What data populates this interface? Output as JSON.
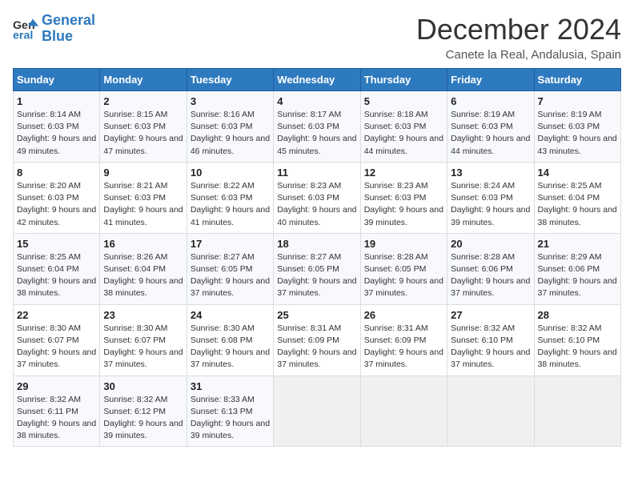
{
  "header": {
    "logo_line1": "General",
    "logo_line2": "Blue",
    "month_title": "December 2024",
    "location": "Canete la Real, Andalusia, Spain"
  },
  "weekdays": [
    "Sunday",
    "Monday",
    "Tuesday",
    "Wednesday",
    "Thursday",
    "Friday",
    "Saturday"
  ],
  "weeks": [
    [
      {
        "day": "1",
        "sunrise": "Sunrise: 8:14 AM",
        "sunset": "Sunset: 6:03 PM",
        "daylight": "Daylight: 9 hours and 49 minutes."
      },
      {
        "day": "2",
        "sunrise": "Sunrise: 8:15 AM",
        "sunset": "Sunset: 6:03 PM",
        "daylight": "Daylight: 9 hours and 47 minutes."
      },
      {
        "day": "3",
        "sunrise": "Sunrise: 8:16 AM",
        "sunset": "Sunset: 6:03 PM",
        "daylight": "Daylight: 9 hours and 46 minutes."
      },
      {
        "day": "4",
        "sunrise": "Sunrise: 8:17 AM",
        "sunset": "Sunset: 6:03 PM",
        "daylight": "Daylight: 9 hours and 45 minutes."
      },
      {
        "day": "5",
        "sunrise": "Sunrise: 8:18 AM",
        "sunset": "Sunset: 6:03 PM",
        "daylight": "Daylight: 9 hours and 44 minutes."
      },
      {
        "day": "6",
        "sunrise": "Sunrise: 8:19 AM",
        "sunset": "Sunset: 6:03 PM",
        "daylight": "Daylight: 9 hours and 44 minutes."
      },
      {
        "day": "7",
        "sunrise": "Sunrise: 8:19 AM",
        "sunset": "Sunset: 6:03 PM",
        "daylight": "Daylight: 9 hours and 43 minutes."
      }
    ],
    [
      {
        "day": "8",
        "sunrise": "Sunrise: 8:20 AM",
        "sunset": "Sunset: 6:03 PM",
        "daylight": "Daylight: 9 hours and 42 minutes."
      },
      {
        "day": "9",
        "sunrise": "Sunrise: 8:21 AM",
        "sunset": "Sunset: 6:03 PM",
        "daylight": "Daylight: 9 hours and 41 minutes."
      },
      {
        "day": "10",
        "sunrise": "Sunrise: 8:22 AM",
        "sunset": "Sunset: 6:03 PM",
        "daylight": "Daylight: 9 hours and 41 minutes."
      },
      {
        "day": "11",
        "sunrise": "Sunrise: 8:23 AM",
        "sunset": "Sunset: 6:03 PM",
        "daylight": "Daylight: 9 hours and 40 minutes."
      },
      {
        "day": "12",
        "sunrise": "Sunrise: 8:23 AM",
        "sunset": "Sunset: 6:03 PM",
        "daylight": "Daylight: 9 hours and 39 minutes."
      },
      {
        "day": "13",
        "sunrise": "Sunrise: 8:24 AM",
        "sunset": "Sunset: 6:03 PM",
        "daylight": "Daylight: 9 hours and 39 minutes."
      },
      {
        "day": "14",
        "sunrise": "Sunrise: 8:25 AM",
        "sunset": "Sunset: 6:04 PM",
        "daylight": "Daylight: 9 hours and 38 minutes."
      }
    ],
    [
      {
        "day": "15",
        "sunrise": "Sunrise: 8:25 AM",
        "sunset": "Sunset: 6:04 PM",
        "daylight": "Daylight: 9 hours and 38 minutes."
      },
      {
        "day": "16",
        "sunrise": "Sunrise: 8:26 AM",
        "sunset": "Sunset: 6:04 PM",
        "daylight": "Daylight: 9 hours and 38 minutes."
      },
      {
        "day": "17",
        "sunrise": "Sunrise: 8:27 AM",
        "sunset": "Sunset: 6:05 PM",
        "daylight": "Daylight: 9 hours and 37 minutes."
      },
      {
        "day": "18",
        "sunrise": "Sunrise: 8:27 AM",
        "sunset": "Sunset: 6:05 PM",
        "daylight": "Daylight: 9 hours and 37 minutes."
      },
      {
        "day": "19",
        "sunrise": "Sunrise: 8:28 AM",
        "sunset": "Sunset: 6:05 PM",
        "daylight": "Daylight: 9 hours and 37 minutes."
      },
      {
        "day": "20",
        "sunrise": "Sunrise: 8:28 AM",
        "sunset": "Sunset: 6:06 PM",
        "daylight": "Daylight: 9 hours and 37 minutes."
      },
      {
        "day": "21",
        "sunrise": "Sunrise: 8:29 AM",
        "sunset": "Sunset: 6:06 PM",
        "daylight": "Daylight: 9 hours and 37 minutes."
      }
    ],
    [
      {
        "day": "22",
        "sunrise": "Sunrise: 8:30 AM",
        "sunset": "Sunset: 6:07 PM",
        "daylight": "Daylight: 9 hours and 37 minutes."
      },
      {
        "day": "23",
        "sunrise": "Sunrise: 8:30 AM",
        "sunset": "Sunset: 6:07 PM",
        "daylight": "Daylight: 9 hours and 37 minutes."
      },
      {
        "day": "24",
        "sunrise": "Sunrise: 8:30 AM",
        "sunset": "Sunset: 6:08 PM",
        "daylight": "Daylight: 9 hours and 37 minutes."
      },
      {
        "day": "25",
        "sunrise": "Sunrise: 8:31 AM",
        "sunset": "Sunset: 6:09 PM",
        "daylight": "Daylight: 9 hours and 37 minutes."
      },
      {
        "day": "26",
        "sunrise": "Sunrise: 8:31 AM",
        "sunset": "Sunset: 6:09 PM",
        "daylight": "Daylight: 9 hours and 37 minutes."
      },
      {
        "day": "27",
        "sunrise": "Sunrise: 8:32 AM",
        "sunset": "Sunset: 6:10 PM",
        "daylight": "Daylight: 9 hours and 37 minutes."
      },
      {
        "day": "28",
        "sunrise": "Sunrise: 8:32 AM",
        "sunset": "Sunset: 6:10 PM",
        "daylight": "Daylight: 9 hours and 38 minutes."
      }
    ],
    [
      {
        "day": "29",
        "sunrise": "Sunrise: 8:32 AM",
        "sunset": "Sunset: 6:11 PM",
        "daylight": "Daylight: 9 hours and 38 minutes."
      },
      {
        "day": "30",
        "sunrise": "Sunrise: 8:32 AM",
        "sunset": "Sunset: 6:12 PM",
        "daylight": "Daylight: 9 hours and 39 minutes."
      },
      {
        "day": "31",
        "sunrise": "Sunrise: 8:33 AM",
        "sunset": "Sunset: 6:13 PM",
        "daylight": "Daylight: 9 hours and 39 minutes."
      },
      null,
      null,
      null,
      null
    ]
  ]
}
